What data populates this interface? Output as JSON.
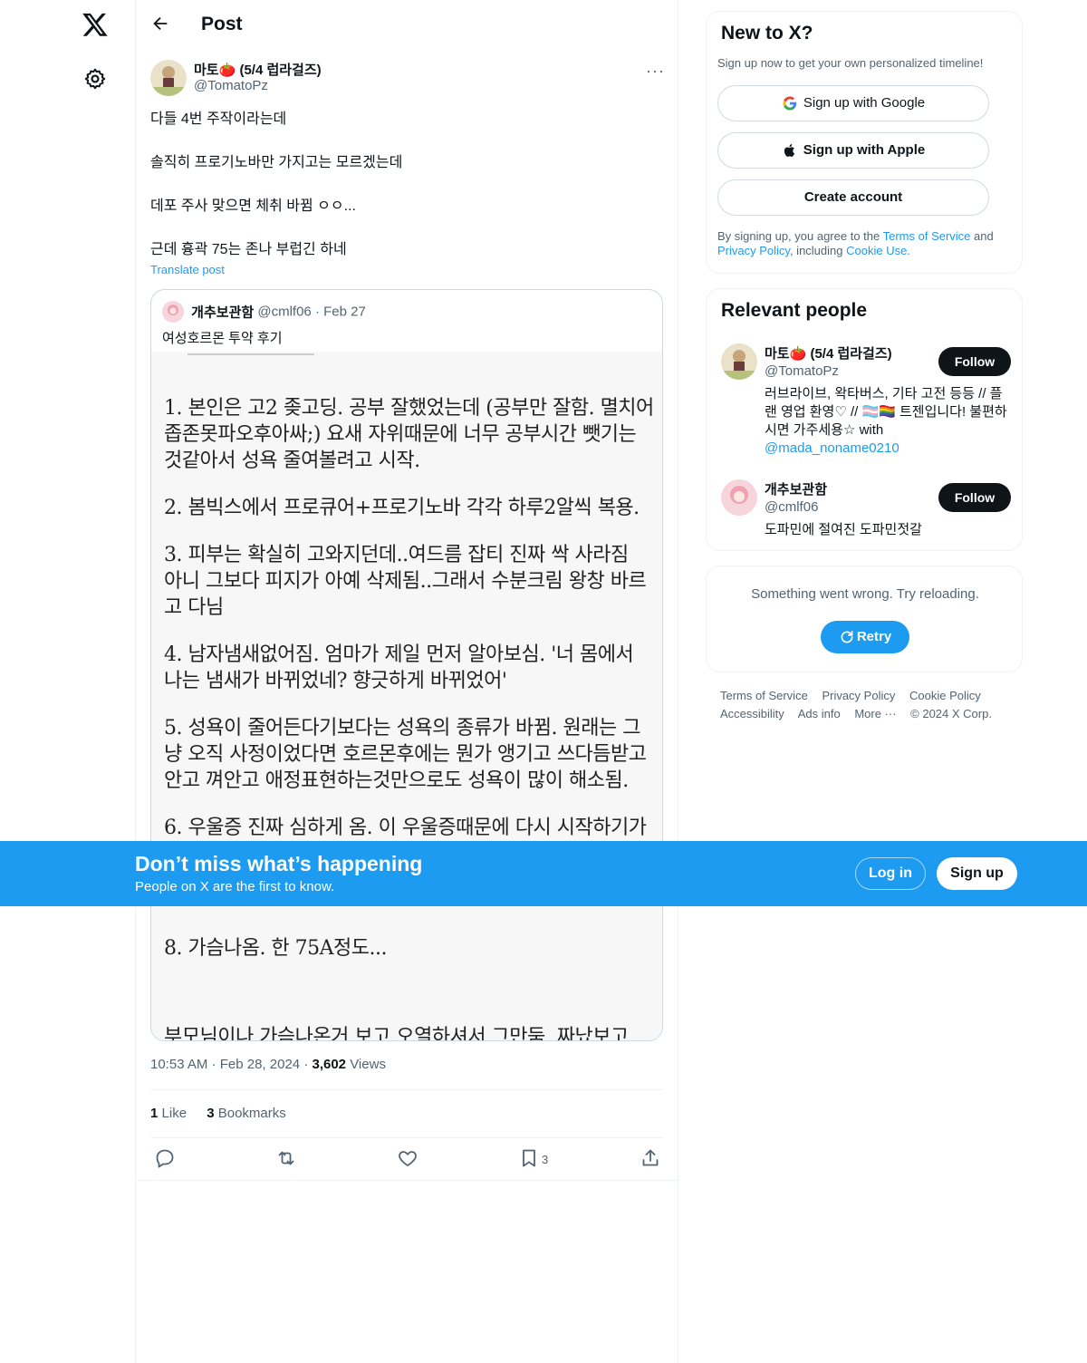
{
  "header": {
    "title": "Post"
  },
  "post": {
    "author_name": "마토🍅 (5/4 럽라걸즈)",
    "author_handle": "@TomatoPz",
    "more_label": "···",
    "paragraphs": [
      "다들 4번 주작이라는데",
      "솔직히 프로기노바만 가지고는 모르겠는데",
      "데포 주사 맞으면 체취 바뀜 ㅇㅇ...",
      "근데 흉곽 75는 존나 부럽긴 하네"
    ],
    "translate_label": "Translate post",
    "quote": {
      "name": "개추보관함",
      "handle": "@cmlf06",
      "dot": "·",
      "date": "Feb 27",
      "text": "여성호르몬 투약 후기",
      "image_lines": [
        "1. 본인은 고2 좆고딩. 공부 잘했었는데 (공부만 잘함. 멸치어",
        "좁존못파오후아싸;) 요새 자위때문에 너무 공부시간 뺏기는",
        "것같아서 성욕 줄여볼려고 시작.",
        "2. 봄빅스에서 프로큐어+프로기노바 각각 하루2알씩 복용.",
        "3. 피부는 확실히 고와지던데..여드름 잡티 진짜 싹 사라짐",
        "아니 그보다 피지가 아예 삭제됨..그래서 수분크림 왕창 바르",
        "고 다님",
        "4. 남자냄새없어짐. 엄마가 제일 먼저 알아보심. '너 몸에서",
        "나는 냄새가 바뀌었네? 향긋하게 바뀌었어'",
        "5. 성욕이 줄어든다기보다는 성욕의 종류가 바뀜. 원래는 그",
        "냥 오직 사정이었다면 호르몬후에는 뭔가 앵기고 쓰다듬받고",
        "안고 껴안고 애정표현하는것만으로도 성욕이 많이 해소됨.",
        "6. 우울증 진짜 심하게 옴. 이 우울증때문에 다시 시작하기가",
        "8. 가슴나옴. 한 75A정도...",
        "부모님이나 가슴나온거 보고 오열하셔서 그만둠. 짜났보고"
      ]
    },
    "time": "10:53 AM",
    "date": "Feb 28, 2024",
    "dot": "·",
    "views_count": "3,602",
    "views_label": "Views",
    "likes_count": "1",
    "likes_label": "Like",
    "bookmarks_count": "3",
    "bookmarks_label": "Bookmarks",
    "bookmark_action_count": "3"
  },
  "signup": {
    "title": "New to X?",
    "subtitle": "Sign up now to get your own personalized timeline!",
    "google": "Sign up with Google",
    "apple": "Sign up with Apple",
    "create": "Create account",
    "terms_prefix": "By signing up, you agree to the ",
    "terms_link": "Terms of Service",
    "terms_and": " and ",
    "privacy_link": "Privacy Policy",
    "terms_including": ", including ",
    "cookie_link": "Cookie Use."
  },
  "relevant": {
    "title": "Relevant people",
    "people": [
      {
        "name": "마토🍅 (5/4 럽라걸즈)",
        "handle": "@TomatoPz",
        "bio": "러브라이브, 왁타버스, 기타 고전 등등 // 플랜 영업 환영♡ // 🏳️‍⚧️🏳️‍🌈 트젠입니다! 불편하시면 가주세용☆ with ",
        "bio_link": "@mada_noname0210",
        "follow": "Follow"
      },
      {
        "name": "개추보관함",
        "handle": "@cmlf06",
        "bio": "도파민에 절여진 도파민젓갈",
        "follow": "Follow"
      }
    ]
  },
  "error": {
    "text": "Something went wrong. Try reloading.",
    "retry": "Retry"
  },
  "footer": {
    "links": [
      "Terms of Service",
      "Privacy Policy",
      "Cookie Policy",
      "Accessibility",
      "Ads info",
      "More ···",
      "© 2024 X Corp."
    ]
  },
  "banner": {
    "title": "Don’t miss what’s happening",
    "subtitle": "People on X are the first to know.",
    "login": "Log in",
    "signup": "Sign up"
  },
  "colors": {
    "accent": "#1d9bf0",
    "text": "#0f1419",
    "muted": "#536471"
  }
}
